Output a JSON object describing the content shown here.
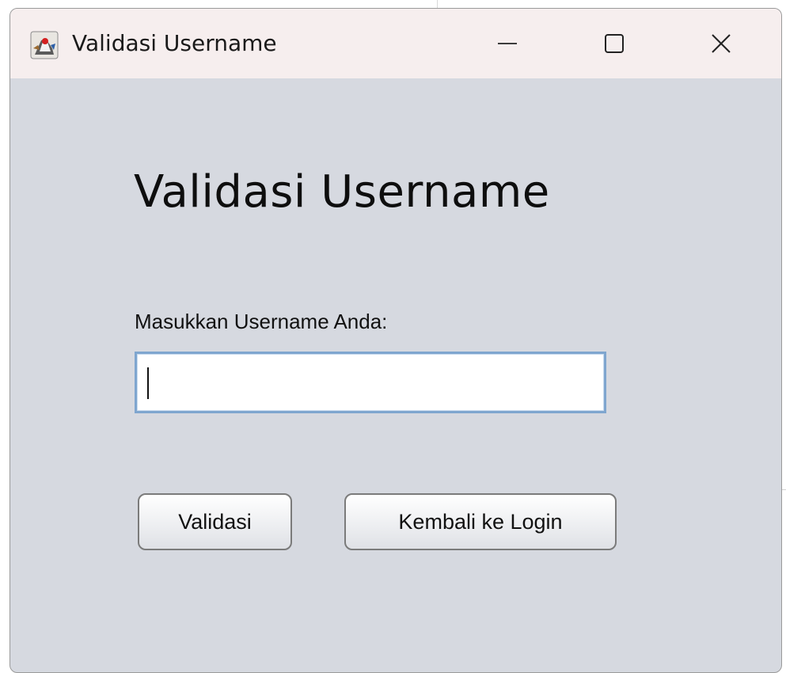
{
  "window": {
    "title": "Validasi Username",
    "app_icon": "java-duke-icon",
    "controls": {
      "minimize_icon": "minimize-icon",
      "maximize_icon": "maximize-icon",
      "close_icon": "close-icon"
    }
  },
  "form": {
    "heading": "Validasi Username",
    "username_label": "Masukkan Username Anda:",
    "username_value": "",
    "buttons": {
      "validate": "Validasi",
      "back_to_login": "Kembali ke Login"
    }
  },
  "colors": {
    "window_background": "#d6d9e0",
    "titlebar_background": "#f6eeee",
    "input_focus_border": "#7fa6cf"
  }
}
